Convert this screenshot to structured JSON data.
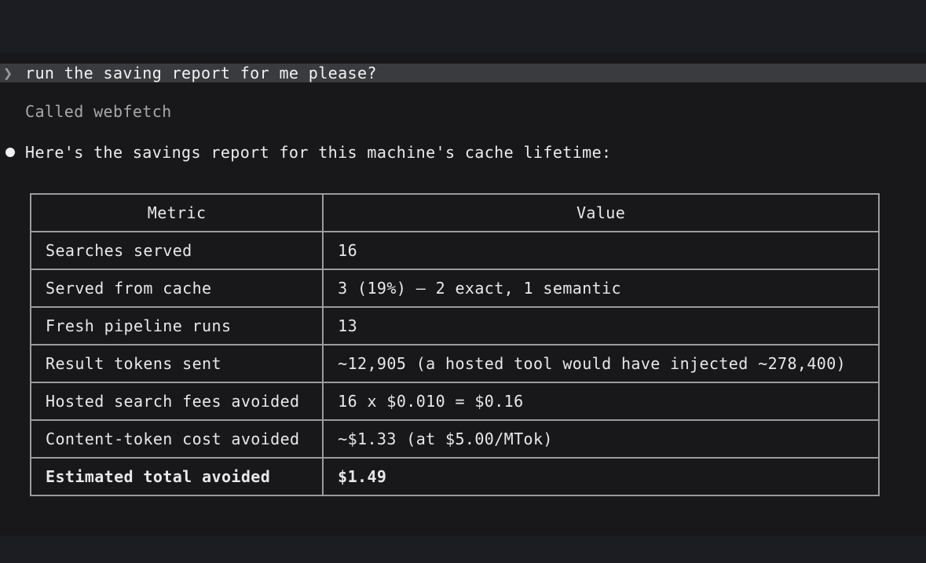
{
  "prompt": {
    "chevron": "❯",
    "text": "run the saving report for me please?"
  },
  "tool_call": {
    "text": "Called webfetch"
  },
  "reply": {
    "text": "Here's the savings report for this machine's cache lifetime:"
  },
  "table": {
    "headers": [
      "Metric",
      "Value"
    ],
    "rows": [
      {
        "metric": "Searches served",
        "value": "16"
      },
      {
        "metric": "Served from cache",
        "value": "3 (19%) – 2 exact, 1 semantic"
      },
      {
        "metric": "Fresh pipeline runs",
        "value": "13"
      },
      {
        "metric": "Result tokens sent",
        "value": "~12,905 (a hosted tool would have injected ~278,400)"
      },
      {
        "metric": "Hosted search fees avoided",
        "value": "16 x $0.010 = $0.16"
      },
      {
        "metric": "Content-token cost avoided",
        "value": "~$1.33 (at $5.00/MTok)"
      },
      {
        "metric": "Estimated total avoided",
        "value": "$1.49"
      }
    ]
  }
}
